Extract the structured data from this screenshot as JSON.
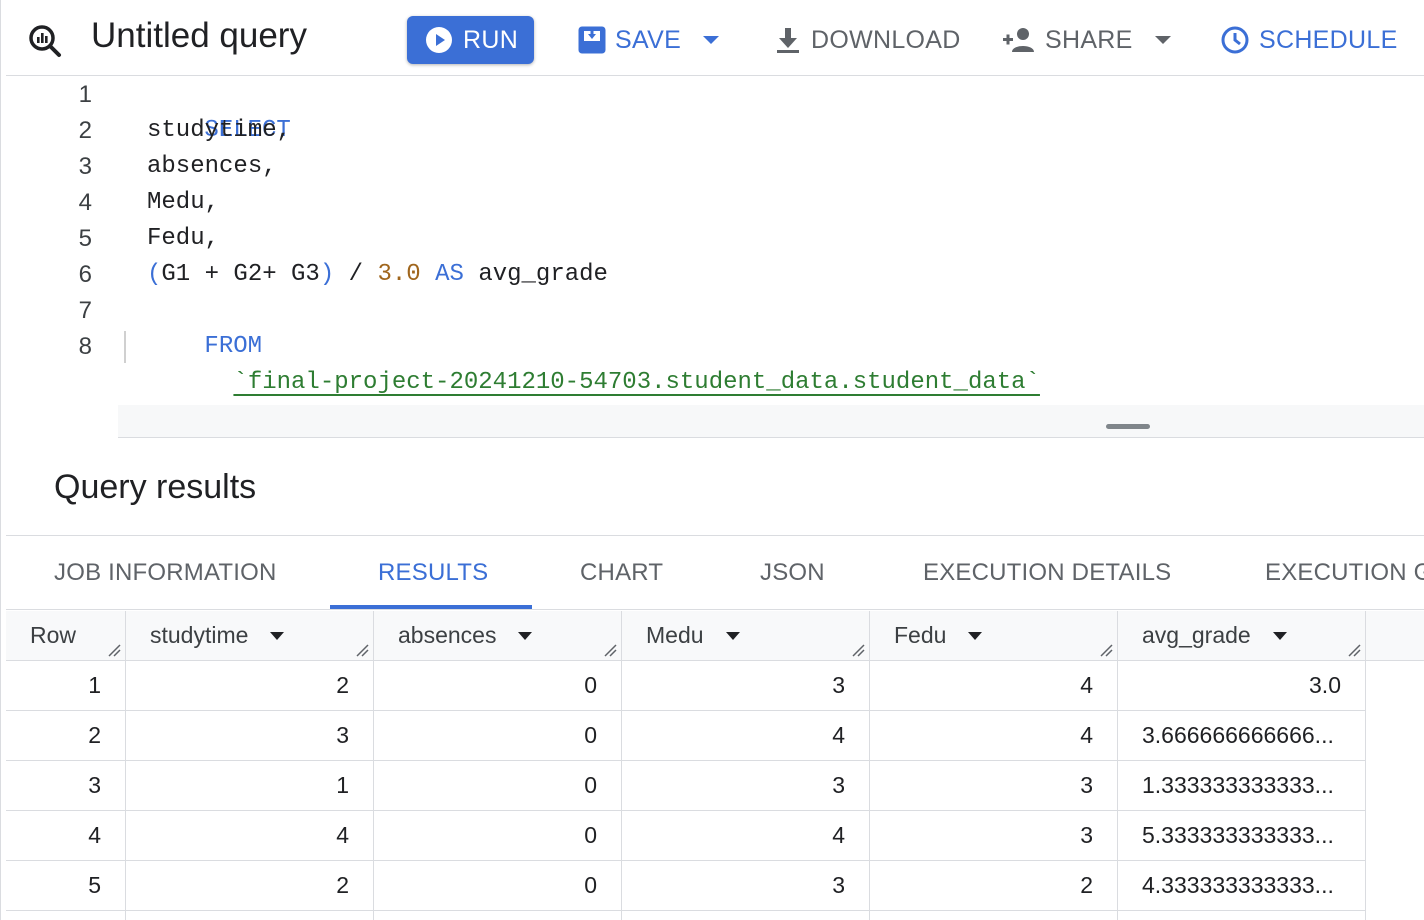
{
  "toolbar": {
    "title": "Untitled query",
    "run_label": "RUN",
    "save_label": "SAVE",
    "download_label": "DOWNLOAD",
    "share_label": "SHARE",
    "schedule_label": "SCHEDULE"
  },
  "editor": {
    "line_numbers": [
      "1",
      "2",
      "3",
      "4",
      "5",
      "6",
      "7",
      "8"
    ],
    "lines": {
      "l1_kw": "SELECT",
      "l2": "studytime,",
      "l3": "absences,",
      "l4": "Medu,",
      "l5": "Fedu,",
      "l6_open": "(",
      "l6_expr": "G1 + G2+ G3",
      "l6_close": ")",
      "l6_div": " / ",
      "l6_num": "3.0",
      "l6_as": "AS",
      "l6_alias": "avg_grade",
      "l7_kw": "FROM",
      "l8_table": "`final-project-20241210-54703.student_data.student_data`"
    }
  },
  "results": {
    "title": "Query results",
    "tabs": [
      "JOB INFORMATION",
      "RESULTS",
      "CHART",
      "JSON",
      "EXECUTION DETAILS",
      "EXECUTION G"
    ],
    "active_tab": "RESULTS",
    "columns": [
      "Row",
      "studytime",
      "absences",
      "Medu",
      "Fedu",
      "avg_grade"
    ],
    "rows": [
      [
        "1",
        "2",
        "0",
        "3",
        "4",
        "3.0"
      ],
      [
        "2",
        "3",
        "0",
        "4",
        "4",
        "3.666666666666..."
      ],
      [
        "3",
        "1",
        "0",
        "3",
        "3",
        "1.333333333333..."
      ],
      [
        "4",
        "4",
        "0",
        "4",
        "3",
        "5.333333333333..."
      ],
      [
        "5",
        "2",
        "0",
        "3",
        "2",
        "4.333333333333..."
      ]
    ]
  },
  "colors": {
    "accent": "#3b6fd6",
    "keyword": "#3b6fd6",
    "number": "#a0661d",
    "string": "#2e7d32"
  }
}
